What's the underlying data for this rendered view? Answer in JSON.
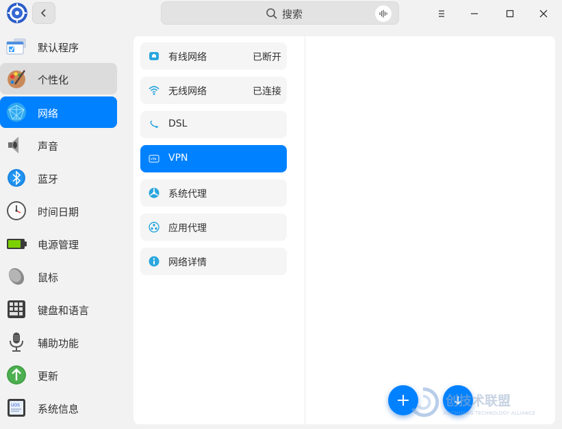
{
  "titlebar": {
    "search_placeholder": "搜索"
  },
  "sidebar": {
    "items": [
      {
        "label": "默认程序",
        "icon": "default-apps-icon",
        "state": "normal"
      },
      {
        "label": "个性化",
        "icon": "personalization-icon",
        "state": "hover"
      },
      {
        "label": "网络",
        "icon": "network-icon",
        "state": "active"
      },
      {
        "label": "声音",
        "icon": "sound-icon",
        "state": "normal"
      },
      {
        "label": "蓝牙",
        "icon": "bluetooth-icon",
        "state": "normal"
      },
      {
        "label": "时间日期",
        "icon": "clock-icon",
        "state": "normal"
      },
      {
        "label": "电源管理",
        "icon": "battery-icon",
        "state": "normal"
      },
      {
        "label": "鼠标",
        "icon": "mouse-icon",
        "state": "normal"
      },
      {
        "label": "键盘和语言",
        "icon": "keyboard-icon",
        "state": "normal"
      },
      {
        "label": "辅助功能",
        "icon": "microphone-icon",
        "state": "normal"
      },
      {
        "label": "更新",
        "icon": "update-icon",
        "state": "normal"
      },
      {
        "label": "系统信息",
        "icon": "system-info-icon",
        "state": "normal"
      }
    ]
  },
  "network": {
    "items": [
      {
        "label": "有线网络",
        "status": "已断开",
        "icon": "wired-icon"
      },
      {
        "label": "无线网络",
        "status": "已连接",
        "icon": "wifi-icon"
      },
      {
        "label": "DSL",
        "status": "",
        "icon": "dsl-icon"
      },
      {
        "label": "VPN",
        "status": "",
        "icon": "vpn-icon",
        "active": true
      },
      {
        "label": "系统代理",
        "status": "",
        "icon": "system-proxy-icon"
      },
      {
        "label": "应用代理",
        "status": "",
        "icon": "app-proxy-icon"
      },
      {
        "label": "网络详情",
        "status": "",
        "icon": "info-icon"
      }
    ]
  },
  "watermark": {
    "text": "创技术联盟",
    "sub": "XINCHUANG TECHNOLOGY ALLIANCE"
  },
  "colors": {
    "accent": "#0081ff",
    "background": "#f2f2f2",
    "panel": "#ffffff"
  }
}
